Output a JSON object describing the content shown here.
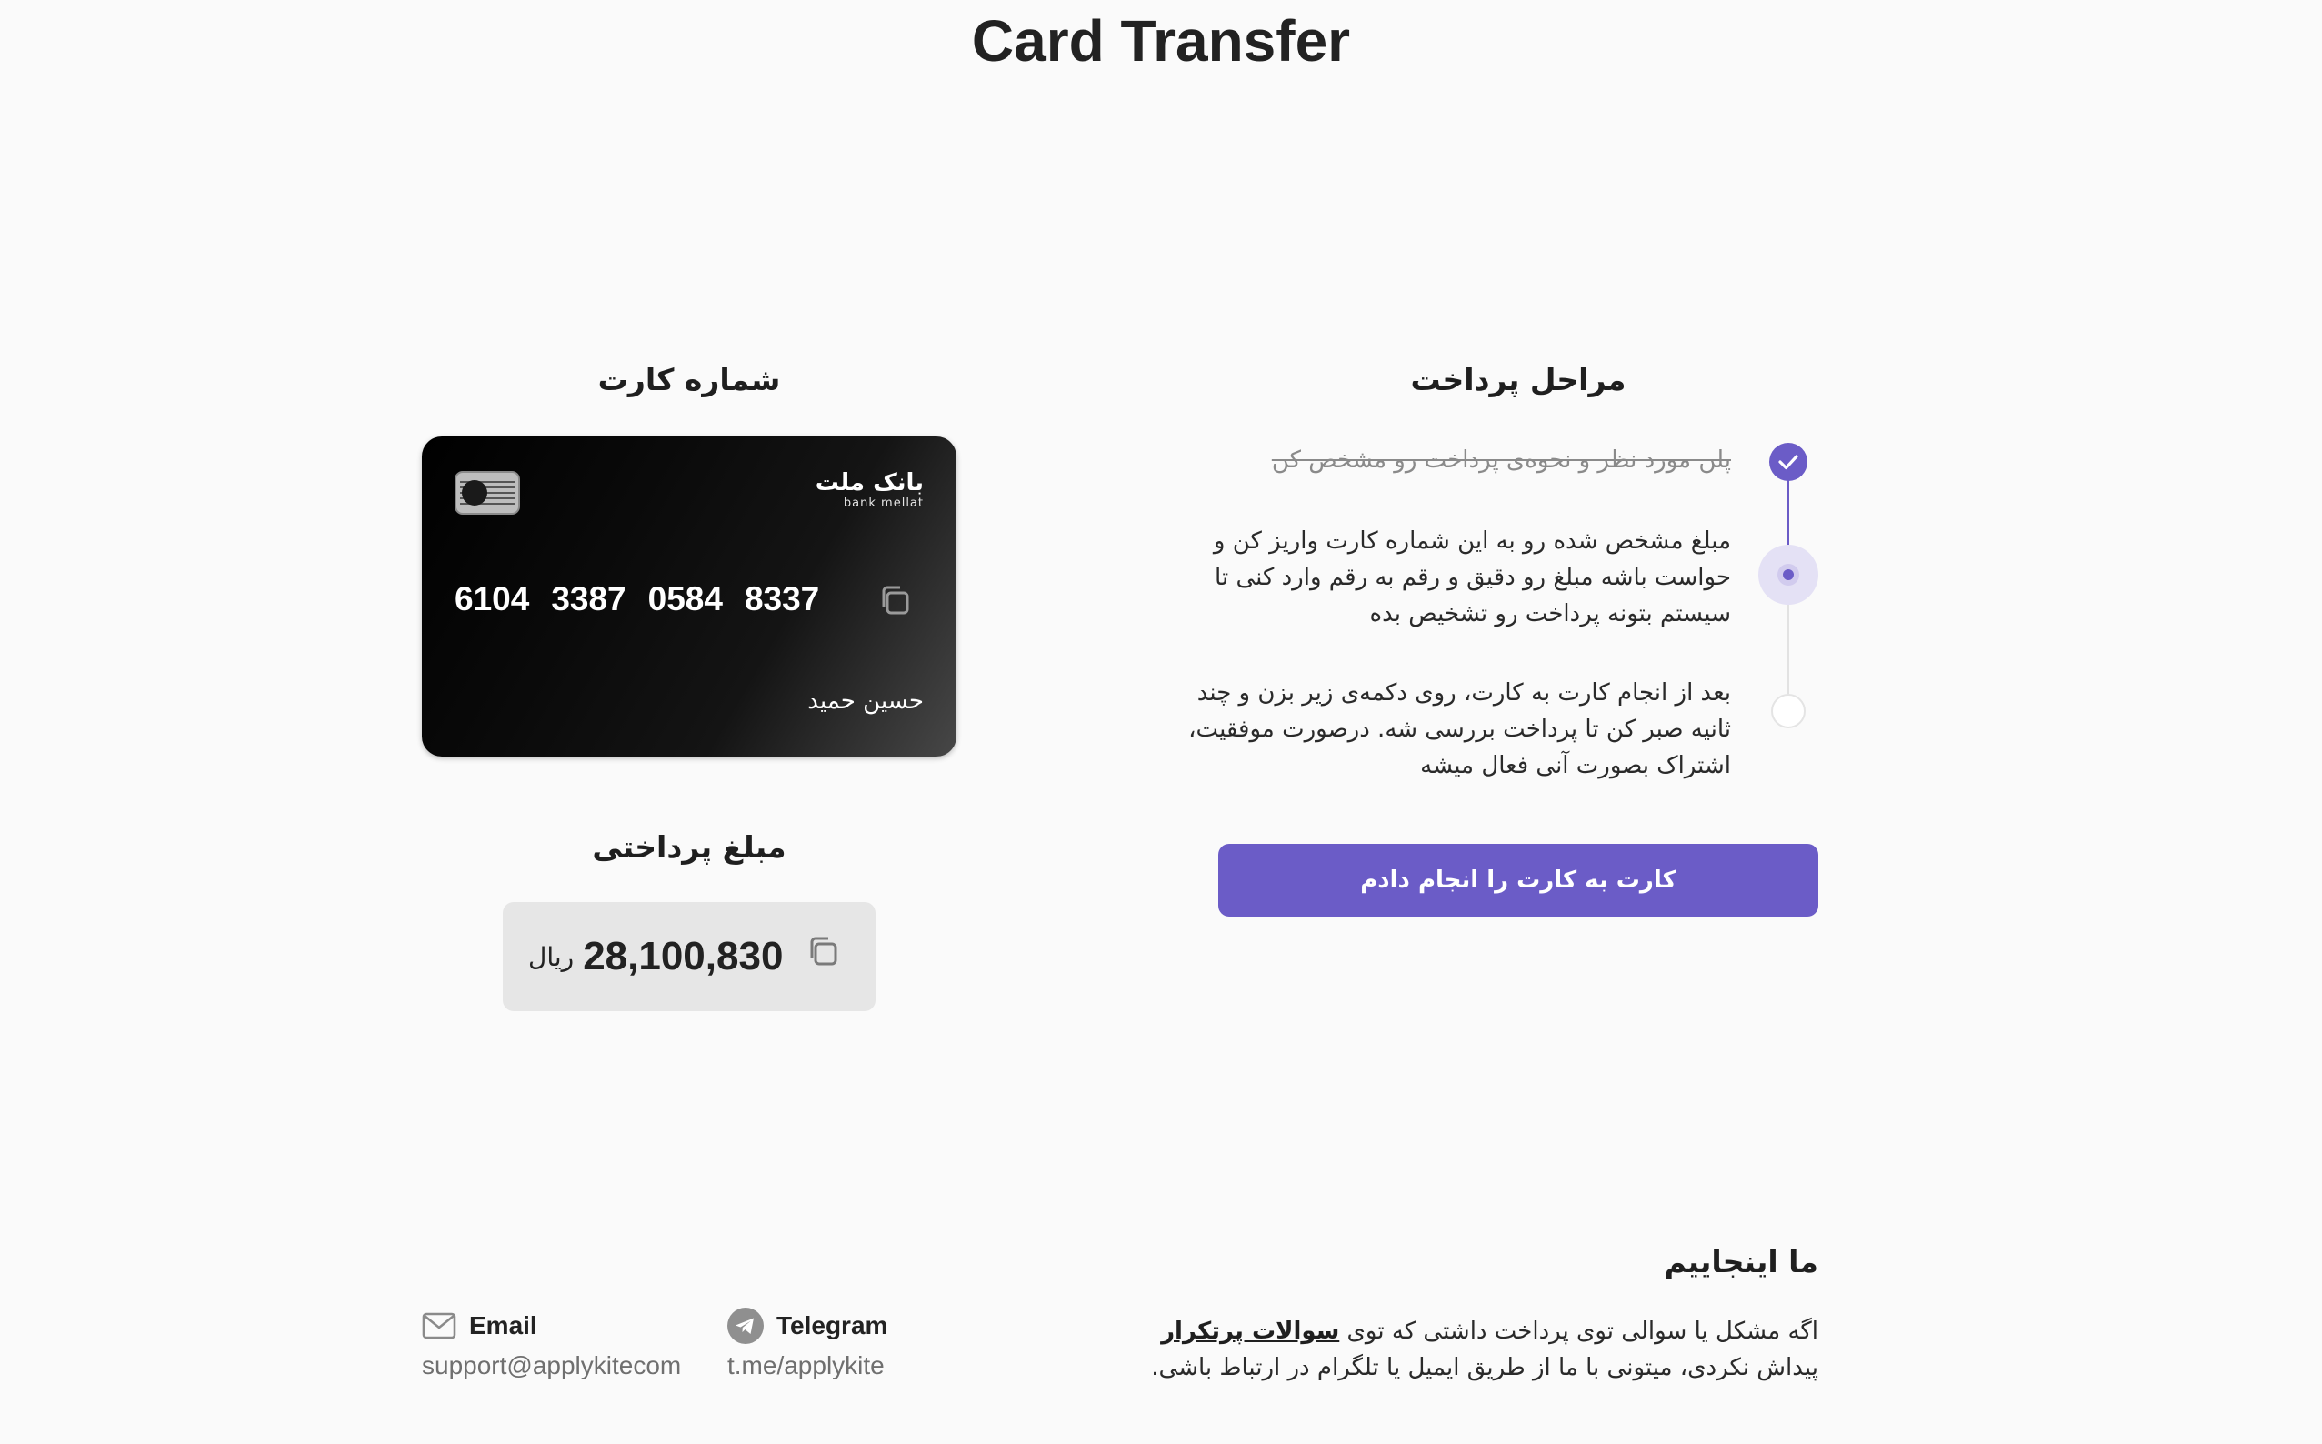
{
  "header": {
    "title": "Card Transfer"
  },
  "card_section": {
    "heading": "شماره کارت",
    "bank_name_fa": "بانک ملت",
    "bank_name_en": "bank mellat",
    "card_number_groups": [
      "6104",
      "3387",
      "0584",
      "8337"
    ],
    "card_holder": "حسین حمید",
    "copy_icon": "copy-icon",
    "chip_icon": "card-chip-icon"
  },
  "amount_section": {
    "heading": "مبلغ پرداختی",
    "amount": "28,100,830",
    "unit": "ریال",
    "copy_icon": "copy-icon"
  },
  "steps_section": {
    "heading": "مراحل پرداخت",
    "steps": [
      {
        "text": "پلن مورد نظر و نحوه‌ی پرداخت رو مشخص کن",
        "status": "done"
      },
      {
        "text": "مبلغ مشخص شده رو به این شماره کارت واریز کن و حواست باشه مبلغ رو دقیق و رقم به رقم وارد کنی تا سیستم بتونه پرداخت رو تشخیص بده",
        "status": "current"
      },
      {
        "text": "بعد از انجام کارت به کارت، روی دکمه‌ی زیر بزن و چند ثانیه صبر کن تا پرداخت بررسی شه. درصورت موفقیت، اشتراک بصورت آنی فعال میشه",
        "status": "pending"
      }
    ],
    "confirm_button_label": "کارت به کارت را انجام دادم"
  },
  "footer": {
    "help_heading": "ما اینجاییم",
    "help_text_before": "اگه مشکل یا سوالی توی پرداخت داشتی که توی ",
    "faq_link_label": "سوالات پرتکرار",
    "help_text_after": " پیداش نکردی، میتونی با ما از طریق ایمیل یا تلگرام در ارتباط باشی.",
    "email": {
      "label": "Email",
      "value": "support@applykitecom",
      "icon": "mail-icon"
    },
    "telegram": {
      "label": "Telegram",
      "value": "t.me/applykite",
      "icon": "telegram-icon"
    }
  },
  "colors": {
    "accent": "#6b5cc7",
    "background": "#fafafa",
    "amount_box": "#e6e6e6"
  }
}
